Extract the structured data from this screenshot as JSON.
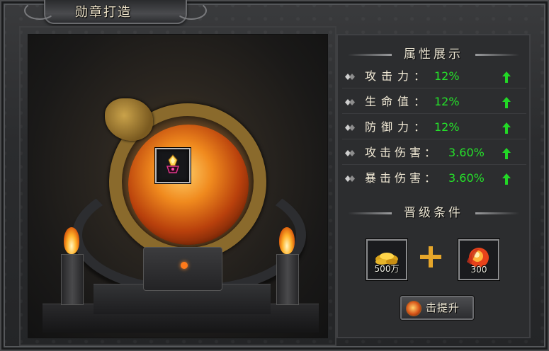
{
  "window": {
    "title": "勋章打造"
  },
  "attributes_section": {
    "heading": "属性展示",
    "items": [
      {
        "name": "攻击力",
        "value": "12%"
      },
      {
        "name": "生命值",
        "value": "12%"
      },
      {
        "name": "防御力",
        "value": "12%"
      },
      {
        "name": "攻击伤害",
        "value": "3.60%"
      },
      {
        "name": "暴击伤害",
        "value": "3.60%"
      }
    ]
  },
  "requirements_section": {
    "heading": "晋级条件",
    "items": [
      {
        "icon": "gold-ingot-icon",
        "quantity": "500万"
      },
      {
        "icon": "fire-orb-icon",
        "quantity": "300"
      }
    ]
  },
  "actions": {
    "upgrade_label": "击提升"
  },
  "colors": {
    "value_green": "#25e02a",
    "accent_gold": "#c9a24a"
  }
}
